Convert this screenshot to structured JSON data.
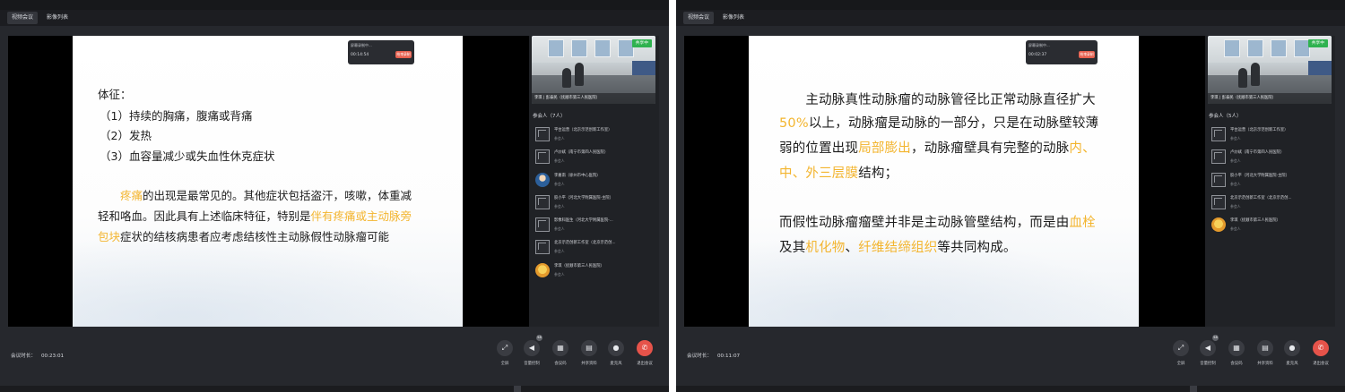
{
  "colors": {
    "highlight": "#f3b52f",
    "share_badge": "#2fb24f",
    "leave_button": "#e6534a"
  },
  "screens": [
    {
      "tabs": [
        "视频会议",
        "影像列表"
      ],
      "recording": {
        "title": "屏幕录制中...",
        "time": "00:14:54",
        "stop": "结束录制"
      },
      "slide": {
        "lines": [
          [
            {
              "t": "体征："
            }
          ],
          [
            {
              "t": "（1）持续的胸痛，腹痛或背痛"
            }
          ],
          [
            {
              "t": "（2）发热"
            }
          ],
          [
            {
              "t": "（3）血容量减少或失血性休克症状"
            }
          ],
          [
            {
              "t": "　　"
            },
            {
              "t": "疼痛",
              "hl": true
            },
            {
              "t": "的出现是最常见的。其他症状包括盗汗，咳嗽，体重减"
            }
          ],
          [
            {
              "t": "轻和咯血。因此具有上述临床特征，特别是"
            },
            {
              "t": "伴有疼痛或主动脉旁",
              "hl": true
            }
          ],
          [
            {
              "t": "包块",
              "hl": true
            },
            {
              "t": "症状的结核病患者应考虑结核性主动脉假性动脉瘤可能"
            }
          ]
        ]
      },
      "video": {
        "share_badge": "共享中",
        "caption": "李琪 | 彭泰民（抚顺市第三人民医院）"
      },
      "participants_title": "参会人（7人）",
      "participants": [
        {
          "name": "平台运营（北京示范创新工作室）",
          "role": "参会人",
          "avatar": "blank"
        },
        {
          "name": "卢炒斌（南宁市第四人民医院）",
          "role": "参会人",
          "avatar": "blank"
        },
        {
          "name": "李嘉南（徐州市中心医院）",
          "role": "参会人",
          "avatar": "photo"
        },
        {
          "name": "胶小平（河北大学附属医院-主院）",
          "role": "参会人",
          "avatar": "blank"
        },
        {
          "name": "影像科医生（河北大学附属医院-...",
          "role": "参会人",
          "avatar": "blank"
        },
        {
          "name": "北京示范创新工作室（北京示范创...",
          "role": "参会人",
          "avatar": "blank"
        },
        {
          "name": "李琪（抚顺市第三人民医院）",
          "role": "参会人",
          "avatar": "cartoon"
        }
      ],
      "meeting_duration_label": "会议时长：",
      "meeting_duration": "00:23:01",
      "controls": [
        {
          "icon": "fullscreen-icon",
          "glyph": "⤢",
          "label": "全屏"
        },
        {
          "icon": "volume-icon",
          "glyph": "◀",
          "label": "音量控制",
          "badge": "58"
        },
        {
          "icon": "grid-icon",
          "glyph": "▦",
          "label": "会议码"
        },
        {
          "icon": "document-icon",
          "glyph": "▤",
          "label": "共享资料"
        },
        {
          "icon": "microphone-icon",
          "glyph": "●",
          "label": "麦克风"
        },
        {
          "icon": "phone-hangup-icon",
          "glyph": "✆",
          "label": "退出会议",
          "red": true
        }
      ]
    },
    {
      "tabs": [
        "视频会议",
        "影像列表"
      ],
      "recording": {
        "title": "屏幕录制中...",
        "time": "00:02:37",
        "stop": "结束录制"
      },
      "slide": {
        "lines": [
          [
            {
              "t": "　　主动脉真性动脉瘤的动脉管径比正常动脉直径扩大"
            }
          ],
          [
            {
              "t": "50%",
              "hl": true
            },
            {
              "t": "以上，动脉瘤是动脉的一部分，只是在动脉壁较薄"
            }
          ],
          [
            {
              "t": "弱的位置出现"
            },
            {
              "t": "局部膨出",
              "hl": true
            },
            {
              "t": "，动脉瘤壁具有完整的动脉"
            },
            {
              "t": "内、",
              "hl": true
            }
          ],
          [
            {
              "t": "中、外三层膜",
              "hl": true
            },
            {
              "t": "结构；"
            }
          ],
          [
            {
              "t": "而假性动脉瘤瘤壁并非是主动脉管壁结构，而是由"
            },
            {
              "t": "血栓",
              "hl": true
            }
          ],
          [
            {
              "t": "及其"
            },
            {
              "t": "机化物",
              "hl": true
            },
            {
              "t": "、"
            },
            {
              "t": "纤维结缔组织",
              "hl": true
            },
            {
              "t": "等共同构成。"
            }
          ]
        ]
      },
      "video": {
        "share_badge": "共享中",
        "caption": "李琪 | 彭泰民（抚顺市第三人民医院）"
      },
      "participants_title": "参会人（5人）",
      "participants": [
        {
          "name": "平台运营（北京示范创新工作室）",
          "role": "参会人",
          "avatar": "blank"
        },
        {
          "name": "卢炒斌（南宁市第四人民医院）",
          "role": "参会人",
          "avatar": "blank"
        },
        {
          "name": "胶小平（河北大学附属医院-主院）",
          "role": "参会人",
          "avatar": "blank"
        },
        {
          "name": "北京示范创新工作室（北京示范创...",
          "role": "参会人",
          "avatar": "blank"
        },
        {
          "name": "李琪（抚顺市第三人民医院）",
          "role": "参会人",
          "avatar": "cartoon"
        }
      ],
      "meeting_duration_label": "会议时长：",
      "meeting_duration": "00:11:07",
      "controls": [
        {
          "icon": "fullscreen-icon",
          "glyph": "⤢",
          "label": "全屏"
        },
        {
          "icon": "volume-icon",
          "glyph": "◀",
          "label": "音量控制",
          "badge": "58"
        },
        {
          "icon": "grid-icon",
          "glyph": "▦",
          "label": "会议码"
        },
        {
          "icon": "document-icon",
          "glyph": "▤",
          "label": "共享资料"
        },
        {
          "icon": "microphone-icon",
          "glyph": "●",
          "label": "麦克风"
        },
        {
          "icon": "phone-hangup-icon",
          "glyph": "✆",
          "label": "退出会议",
          "red": true
        }
      ]
    }
  ]
}
